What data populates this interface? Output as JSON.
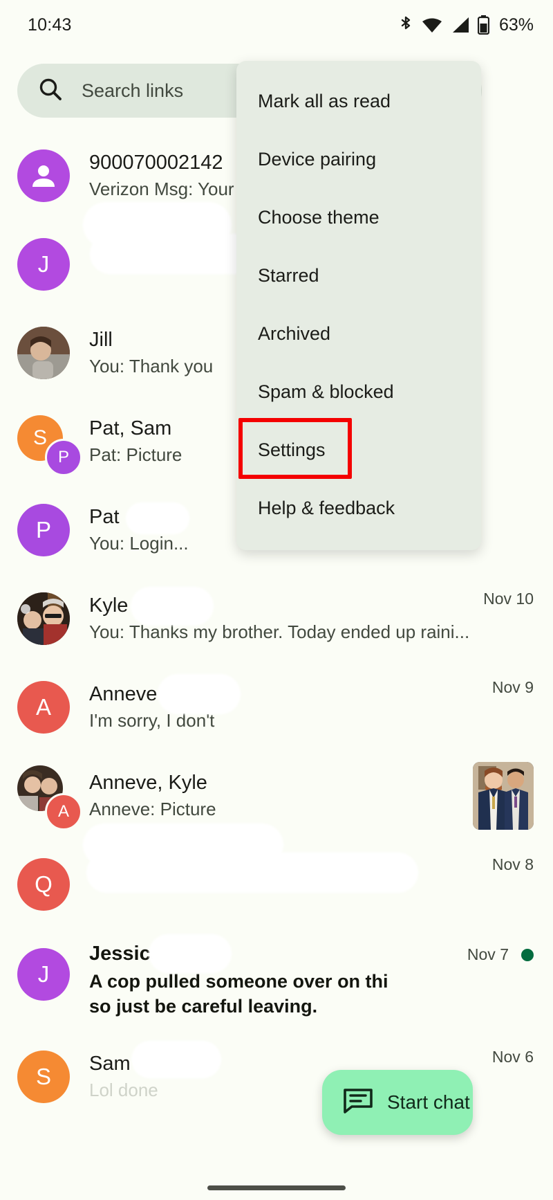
{
  "status_bar": {
    "time": "10:43",
    "battery_percent": "63%",
    "icons": [
      "bluetooth-icon",
      "wifi-icon",
      "cellular-signal-icon",
      "battery-icon"
    ]
  },
  "search": {
    "icon": "search-icon",
    "placeholder": "Search links"
  },
  "overflow_menu": {
    "items": [
      {
        "label": "Mark all as read"
      },
      {
        "label": "Device pairing"
      },
      {
        "label": "Choose theme"
      },
      {
        "label": "Starred"
      },
      {
        "label": "Archived"
      },
      {
        "label": "Spam & blocked"
      },
      {
        "label": "Settings",
        "highlighted": true
      },
      {
        "label": "Help & feedback"
      }
    ],
    "highlight_color": "#f40000"
  },
  "conversations": [
    {
      "title": "900070002142",
      "snippet": "Verizon Msg: Your Dec",
      "date": "",
      "avatar": {
        "type": "icon",
        "glyph": "person-icon",
        "color": "#b24ae0"
      },
      "unread": false,
      "redacted": false
    },
    {
      "title": "",
      "snippet": "",
      "date": "",
      "avatar": {
        "type": "letter",
        "glyph": "J",
        "color": "#b24ae0"
      },
      "unread": false,
      "redacted": true
    },
    {
      "title": "Jill",
      "snippet": "You: Thank you",
      "date": "",
      "avatar": {
        "type": "photo",
        "color": "#7a6354"
      },
      "unread": false,
      "redacted": false
    },
    {
      "title": "Pat, Sam",
      "snippet": "Pat: Picture",
      "date": "",
      "avatar": {
        "type": "group",
        "glyph": "S",
        "color": "#f58a33",
        "badge_glyph": "P",
        "badge_color": "#a84ae0"
      },
      "unread": false,
      "redacted": false
    },
    {
      "title": "Pat",
      "snippet": "You: Login...",
      "date": "",
      "avatar": {
        "type": "letter",
        "glyph": "P",
        "color": "#a84ae0"
      },
      "unread": false,
      "redacted": true
    },
    {
      "title": "Kyle",
      "snippet": "You: Thanks my brother. Today ended up raini...",
      "date": "Nov 10",
      "avatar": {
        "type": "photo",
        "color": "#4a3a2e"
      },
      "unread": false,
      "redacted": true
    },
    {
      "title": "Anneve",
      "snippet": "I'm sorry, I don't",
      "date": "Nov 9",
      "avatar": {
        "type": "letter",
        "glyph": "A",
        "color": "#e8594f"
      },
      "unread": false,
      "redacted": true
    },
    {
      "title": "Anneve, Kyle",
      "snippet": "Anneve: Picture",
      "date": "",
      "avatar": {
        "type": "group-photo",
        "badge_glyph": "A",
        "badge_color": "#e8594f"
      },
      "unread": false,
      "redacted": false,
      "thumbnail": "two-men-in-suits-photo"
    },
    {
      "title": "",
      "snippet": "",
      "date": "Nov 8",
      "avatar": {
        "type": "letter",
        "glyph": "Q",
        "color": "#e8594f"
      },
      "unread": false,
      "redacted": true
    },
    {
      "title": "Jessica",
      "snippet": "A cop pulled someone over on thi\nso just be careful leaving.",
      "date": "Nov 7",
      "avatar": {
        "type": "letter",
        "glyph": "J",
        "color": "#b24ae0"
      },
      "unread": true,
      "unread_dot_color": "#046c3f",
      "redacted": true
    },
    {
      "title": "Sam",
      "snippet": "Lol done",
      "date": "Nov 6",
      "avatar": {
        "type": "letter",
        "glyph": "S",
        "color": "#f58a33"
      },
      "unread": false,
      "redacted": true
    }
  ],
  "fab": {
    "label": "Start chat",
    "icon": "message-compose-icon",
    "color": "#8ff0b4"
  }
}
